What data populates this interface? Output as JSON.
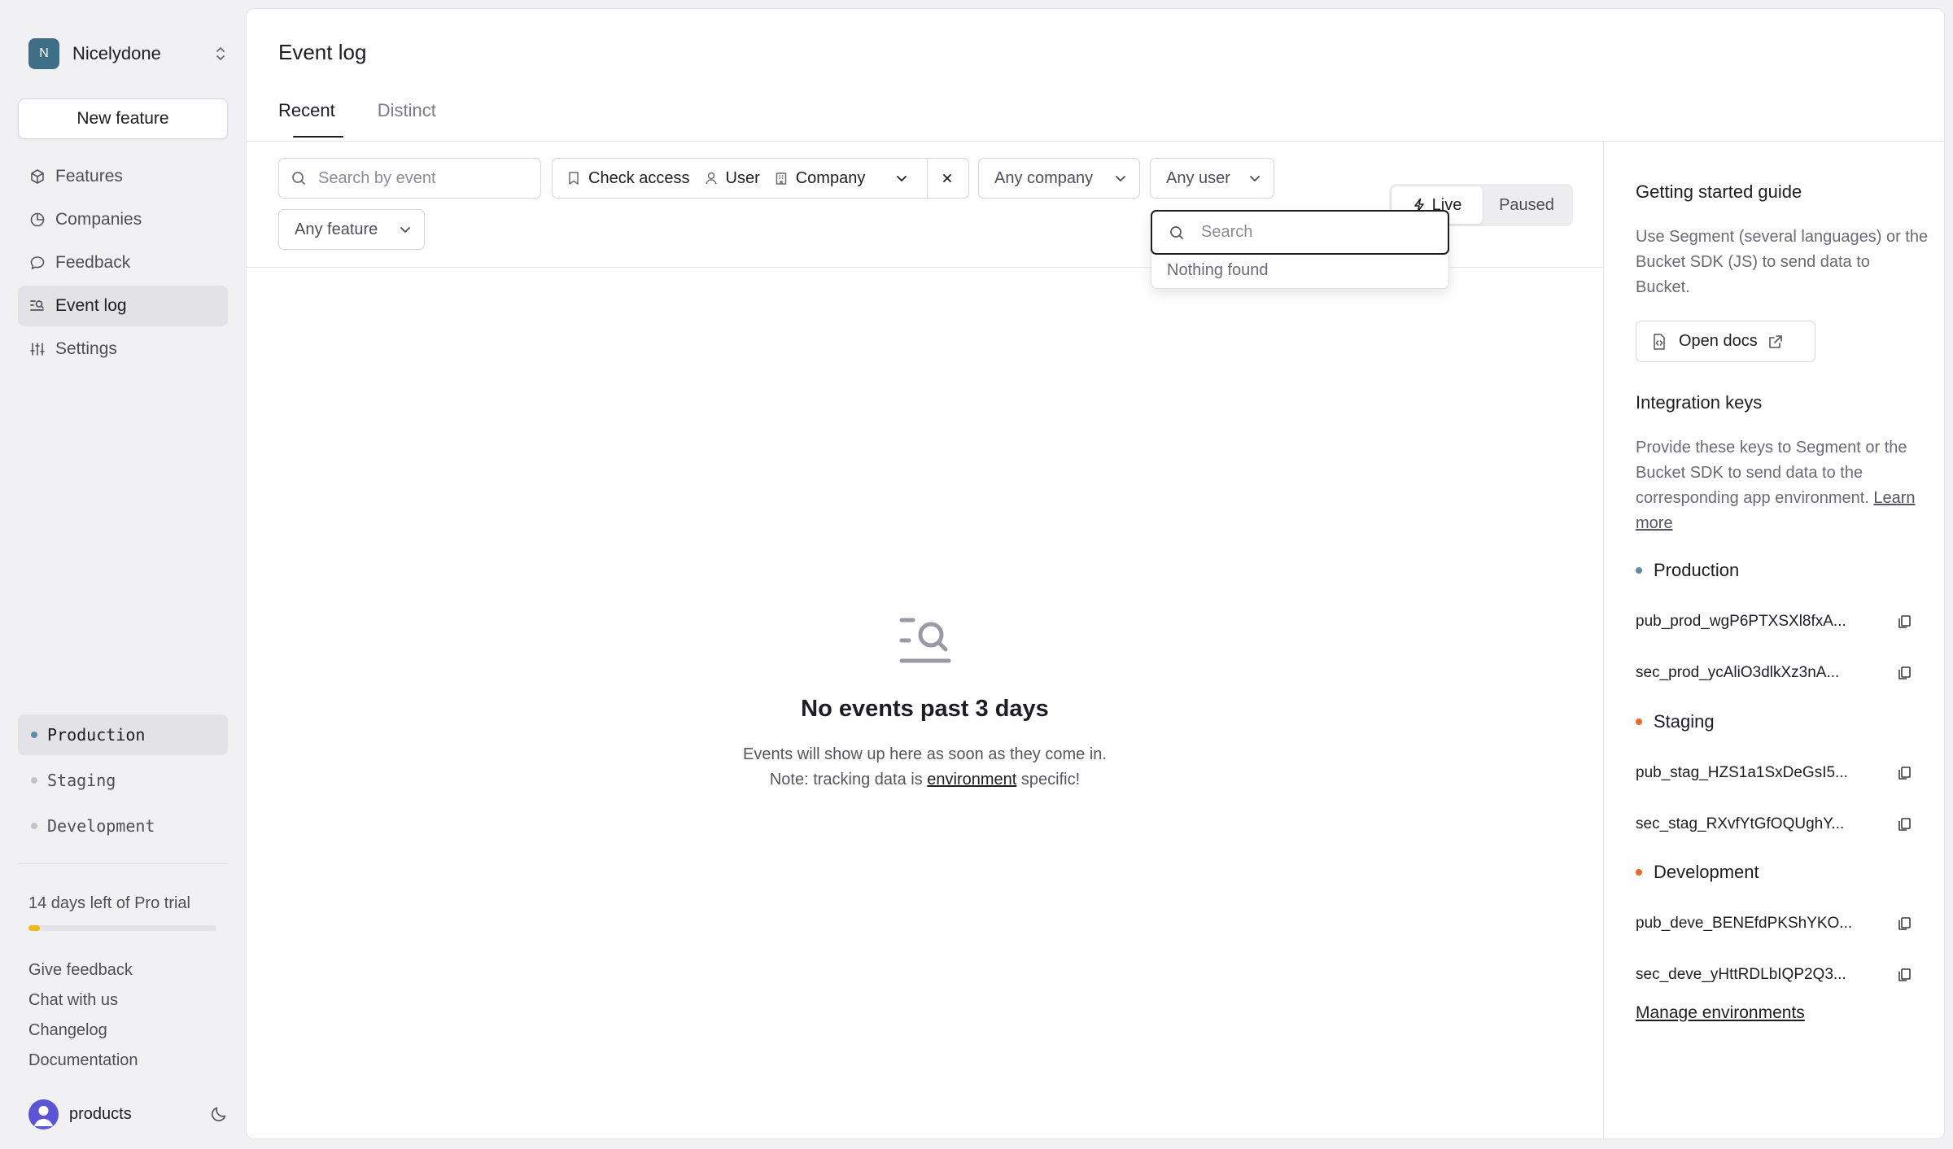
{
  "org": {
    "initial": "N",
    "name": "Nicelydone"
  },
  "sidebar": {
    "new_feature": "New feature",
    "nav": [
      {
        "label": "Features",
        "icon": "cube-icon"
      },
      {
        "label": "Companies",
        "icon": "pie-chart-icon"
      },
      {
        "label": "Feedback",
        "icon": "chat-bubble-icon"
      },
      {
        "label": "Event log",
        "icon": "event-log-icon",
        "active": true
      },
      {
        "label": "Settings",
        "icon": "sliders-icon"
      }
    ],
    "environments": [
      {
        "label": "Production",
        "color": "#5b8fa3",
        "active": true
      },
      {
        "label": "Staging",
        "color": "#c2c2c8"
      },
      {
        "label": "Development",
        "color": "#c2c2c8"
      }
    ],
    "trial": {
      "text": "14 days left of Pro trial",
      "progress": 0.06,
      "color": "#f1b81c"
    },
    "links": [
      "Give feedback",
      "Chat with us",
      "Changelog",
      "Documentation"
    ],
    "user": {
      "name": "products"
    }
  },
  "main": {
    "title": "Event log",
    "tabs": [
      {
        "label": "Recent",
        "active": true
      },
      {
        "label": "Distinct"
      }
    ],
    "filters": {
      "search_placeholder": "Search by event",
      "type_filter": {
        "check_access": "Check access",
        "user": "User",
        "company": "Company"
      },
      "any_company": "Any company",
      "any_user": "Any user",
      "any_feature": "Any feature"
    },
    "live_toggle": {
      "live": "Live",
      "paused": "Paused",
      "selected": "Live"
    },
    "user_dropdown": {
      "search_placeholder": "Search",
      "empty": "Nothing found"
    },
    "empty_state": {
      "title": "No events past 3 days",
      "desc_before": "Events will show up here as soon as they come in. Note: tracking data is ",
      "desc_link": "environment",
      "desc_after": " specific!"
    }
  },
  "panel": {
    "guide_title": "Getting started guide",
    "guide_text": "Use Segment (several languages) or the Bucket SDK (JS) to send data to Bucket.",
    "open_docs": "Open docs",
    "keys_title": "Integration keys",
    "keys_text": "Provide these keys to Segment or the Bucket SDK to send data to the corresponding app environment. ",
    "learn_more": "Learn more",
    "environments": [
      {
        "name": "Production",
        "color": "#5b8fa3",
        "pub": "pub_prod_wgP6PTXSXl8fxA...",
        "sec": "sec_prod_ycAliO3dlkXz3nA..."
      },
      {
        "name": "Staging",
        "color": "#e8692a",
        "pub": "pub_stag_HZS1a1SxDeGsI5...",
        "sec": "sec_stag_RXvfYtGfOQUghY..."
      },
      {
        "name": "Development",
        "color": "#e8692a",
        "pub": "pub_deve_BENEfdPKShYKO...",
        "sec": "sec_deve_yHttRDLbIQP2Q3..."
      }
    ],
    "manage": "Manage environments"
  }
}
